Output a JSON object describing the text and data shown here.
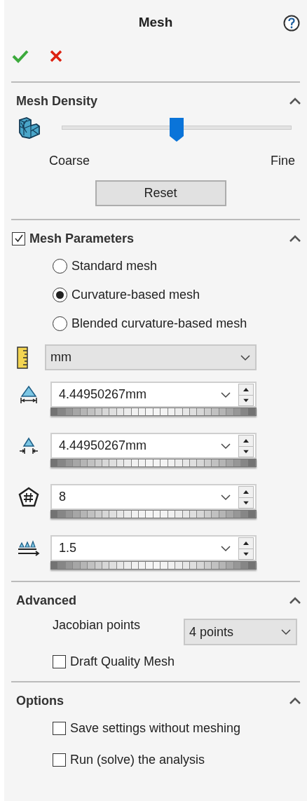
{
  "title": "Mesh",
  "mesh_density": {
    "heading": "Mesh Density",
    "expanded": true,
    "level": 0.5,
    "min_label": "Coarse",
    "max_label": "Fine",
    "reset": "Reset"
  },
  "mesh_parameters": {
    "heading": "Mesh Parameters",
    "checked": true,
    "expanded": true,
    "radios": [
      {
        "label": "Standard mesh",
        "selected": false
      },
      {
        "label": "Curvature-based mesh",
        "selected": true
      },
      {
        "label": "Blended curvature-based mesh",
        "selected": false
      }
    ],
    "unit": "mm",
    "fields": [
      {
        "value": "4.44950267mm"
      },
      {
        "value": "4.44950267mm"
      },
      {
        "value": "8"
      },
      {
        "value": "1.5"
      }
    ]
  },
  "advanced": {
    "heading": "Advanced",
    "expanded": true,
    "jacobian_label": "Jacobian points",
    "jacobian_value": "4 points",
    "checkboxes": [
      {
        "label": "Draft Quality Mesh",
        "checked": false
      }
    ]
  },
  "options": {
    "heading": "Options",
    "expanded": true,
    "checkboxes": [
      {
        "label": "Save settings without meshing",
        "checked": false
      },
      {
        "label": "Run (solve) the analysis",
        "checked": false
      }
    ]
  }
}
